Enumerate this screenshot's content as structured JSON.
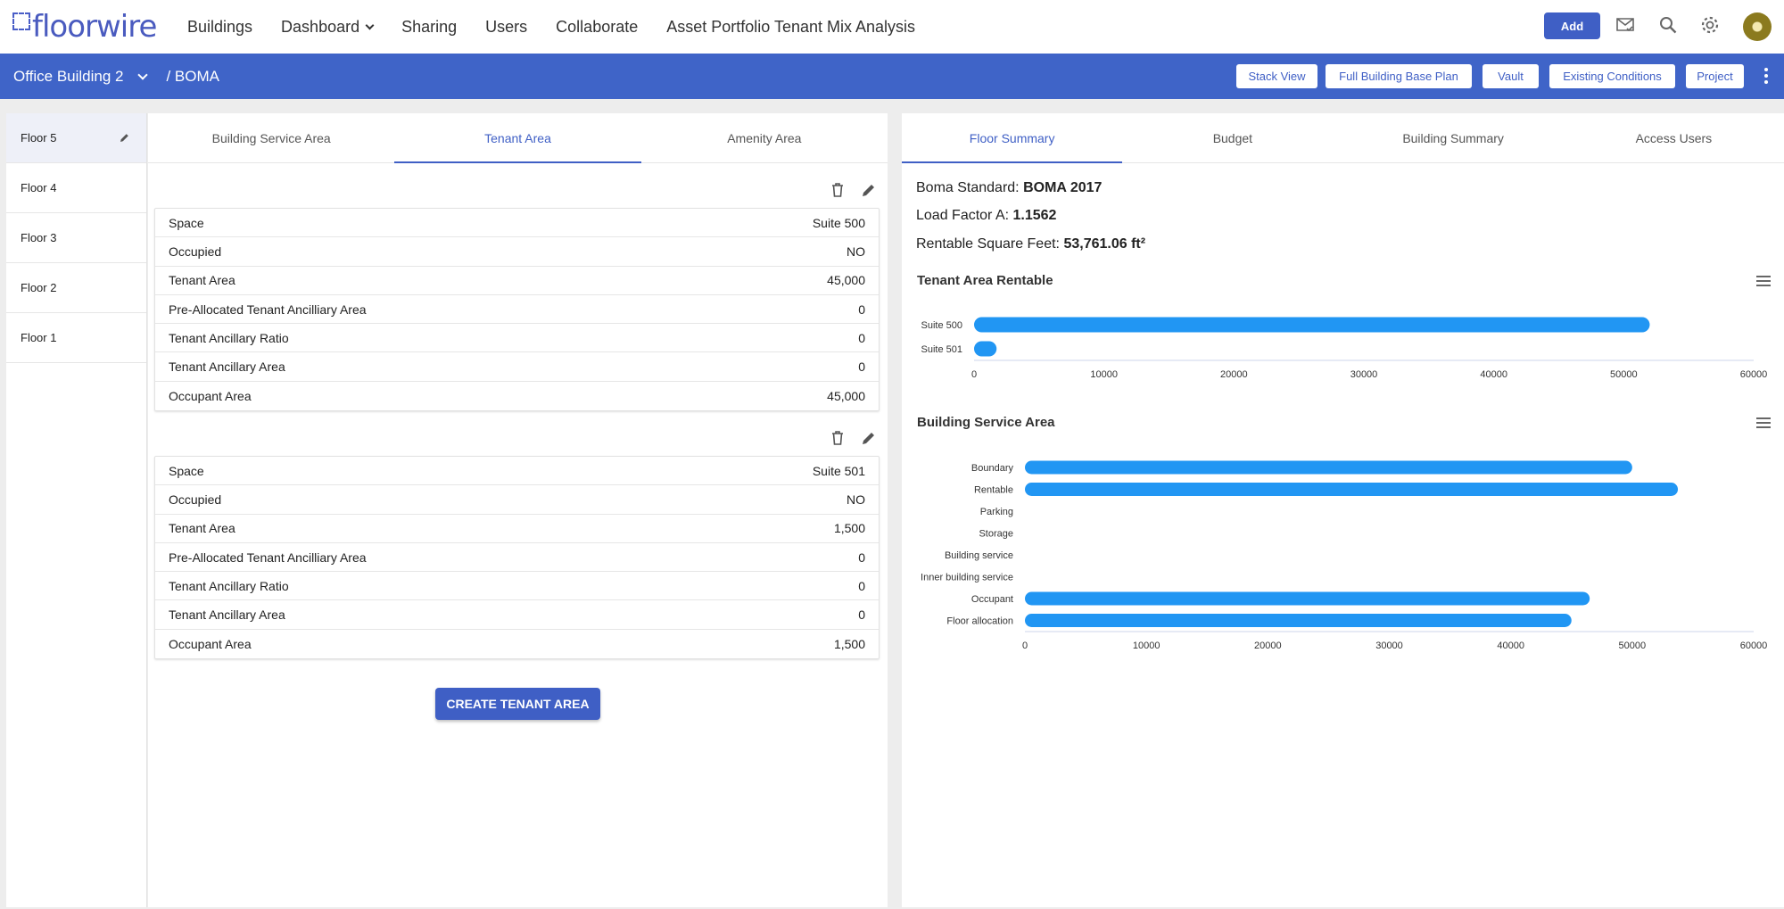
{
  "app": {
    "logo_text": "floorwire"
  },
  "nav": {
    "items": [
      {
        "label": "Buildings",
        "has_dropdown": false
      },
      {
        "label": "Dashboard",
        "has_dropdown": true
      },
      {
        "label": "Sharing",
        "has_dropdown": false
      },
      {
        "label": "Users",
        "has_dropdown": false
      },
      {
        "label": "Collaborate",
        "has_dropdown": false
      },
      {
        "label": "Asset Portfolio Tenant Mix Analysis",
        "has_dropdown": false
      }
    ],
    "add_label": "Add",
    "icons": [
      "mail-check-icon",
      "search-icon",
      "gear-icon",
      "avatar"
    ]
  },
  "breadcrumb": {
    "building": "Office Building 2",
    "section": "/ BOMA"
  },
  "toolbar": {
    "buttons": [
      "Stack View",
      "Full Building Base Plan",
      "Vault",
      "Existing Conditions",
      "Project"
    ]
  },
  "floors": [
    "Floor 5",
    "Floor 4",
    "Floor 3",
    "Floor 2",
    "Floor 1"
  ],
  "area_tabs": [
    "Building Service Area",
    "Tenant Area",
    "Amenity Area"
  ],
  "tenant_cards": [
    {
      "rows": [
        [
          "Space",
          "Suite 500"
        ],
        [
          "Occupied",
          "NO"
        ],
        [
          "Tenant Area",
          "45,000"
        ],
        [
          "Pre-Allocated Tenant Ancilliary Area",
          "0"
        ],
        [
          "Tenant Ancillary Ratio",
          "0"
        ],
        [
          "Tenant Ancillary Area",
          "0"
        ],
        [
          "Occupant Area",
          "45,000"
        ]
      ]
    },
    {
      "rows": [
        [
          "Space",
          "Suite 501"
        ],
        [
          "Occupied",
          "NO"
        ],
        [
          "Tenant Area",
          "1,500"
        ],
        [
          "Pre-Allocated Tenant Ancilliary Area",
          "0"
        ],
        [
          "Tenant Ancillary Ratio",
          "0"
        ],
        [
          "Tenant Ancillary Area",
          "0"
        ],
        [
          "Occupant Area",
          "1,500"
        ]
      ]
    }
  ],
  "create_label": "CREATE TENANT AREA",
  "summary_tabs": [
    "Floor Summary",
    "Budget",
    "Building Summary",
    "Access Users"
  ],
  "summary": {
    "boma_label": "Boma Standard:",
    "boma_value": "BOMA 2017",
    "load_label": "Load Factor A:",
    "load_value": "1.1562",
    "rsf_label": "Rentable Square Feet:",
    "rsf_value": "53,761.06 ft²"
  },
  "colors": {
    "accent": "#3f5fc5",
    "bar": "#2196f3",
    "subbar": "#3f64c8"
  },
  "chart_data": [
    {
      "type": "bar",
      "orientation": "horizontal",
      "title": "Tenant Area Rentable",
      "categories": [
        "Suite 500",
        "Suite 501"
      ],
      "values": [
        52000,
        1734
      ],
      "xlim": [
        0,
        60000
      ],
      "xticks": [
        0,
        10000,
        20000,
        30000,
        40000,
        50000,
        60000
      ]
    },
    {
      "type": "bar",
      "orientation": "horizontal",
      "title": "Building Service Area",
      "categories": [
        "Boundary",
        "Rentable",
        "Parking",
        "Storage",
        "Building service",
        "Inner building service",
        "Occupant",
        "Floor allocation"
      ],
      "values": [
        50000,
        53761,
        0,
        0,
        0,
        0,
        46500,
        45000
      ],
      "xlim": [
        0,
        60000
      ],
      "xticks": [
        0,
        10000,
        20000,
        30000,
        40000,
        50000,
        60000
      ]
    }
  ]
}
